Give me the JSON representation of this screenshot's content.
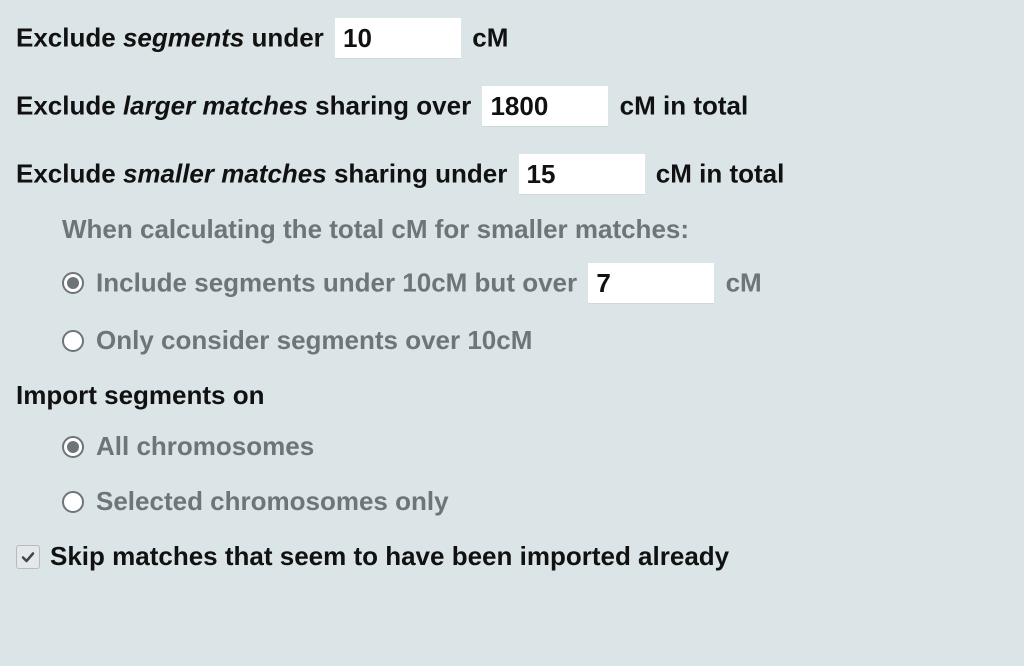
{
  "exclude_segments": {
    "prefix": "Exclude ",
    "em": "segments",
    "mid": " under",
    "value": "10",
    "suffix": "cM"
  },
  "exclude_larger": {
    "prefix": "Exclude ",
    "em": "larger matches",
    "mid": " sharing over",
    "value": "1800",
    "suffix": "cM in total"
  },
  "exclude_smaller": {
    "prefix": "Exclude ",
    "em": "smaller matches",
    "mid": " sharing under",
    "value": "15",
    "suffix": "cM in total"
  },
  "smaller_sub": {
    "heading": "When calculating the total cM for smaller matches:",
    "opt1_prefix": "Include segments under 10cM but over",
    "opt1_value": "7",
    "opt1_suffix": "cM",
    "opt2_label": "Only consider segments over 10cM",
    "selected": "opt1"
  },
  "import_section": {
    "label": "Import segments on",
    "opt1_label": "All chromosomes",
    "opt2_label": "Selected chromosomes only",
    "selected": "opt1"
  },
  "skip": {
    "label": "Skip matches that seem to have been imported already",
    "checked": true
  }
}
